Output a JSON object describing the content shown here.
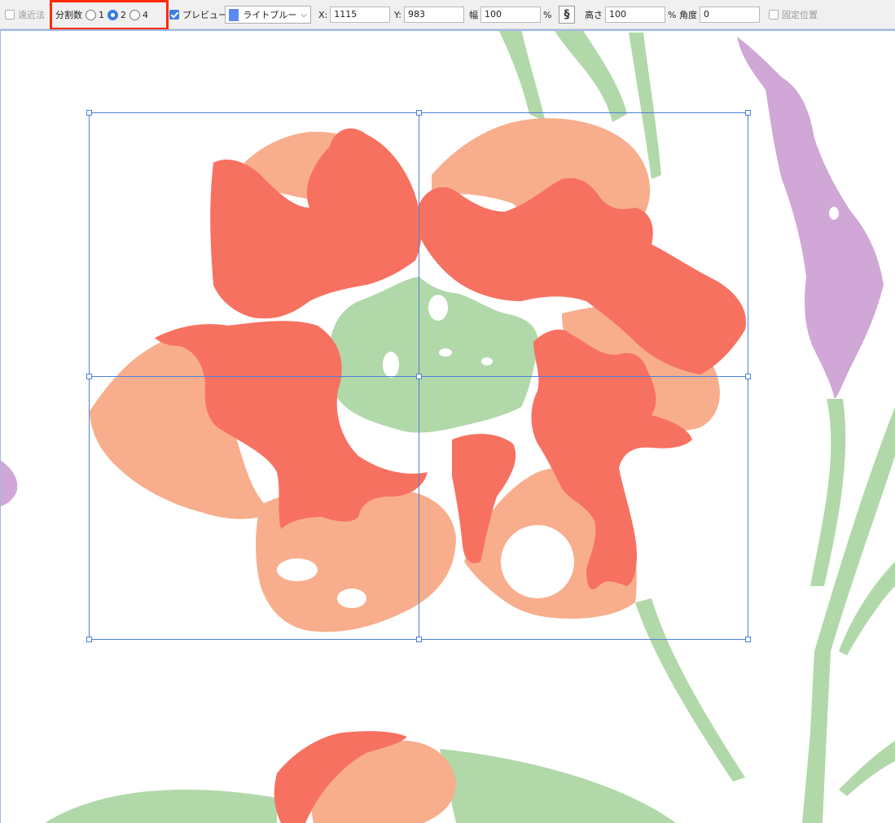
{
  "toolbar": {
    "perspective": {
      "label": "遠近法",
      "checked": false,
      "enabled": false
    },
    "divisions": {
      "label": "分割数",
      "options": [
        "1",
        "2",
        "4"
      ],
      "selected": "2"
    },
    "preview": {
      "label": "プレビュー",
      "checked": true
    },
    "color": {
      "value": "ライトブルー",
      "swatch": "#5b8bf0"
    },
    "x": {
      "label": "X:",
      "value": "1115"
    },
    "y": {
      "label": "Y:",
      "value": "983"
    },
    "width": {
      "label": "幅",
      "value": "100",
      "unit": "%"
    },
    "link_icon": "link-chain-icon",
    "height": {
      "label": "高さ",
      "value": "100",
      "unit": "%"
    },
    "angle": {
      "label": "角度",
      "value": "0"
    },
    "fixed_position": {
      "label": "固定位置",
      "checked": false,
      "enabled": false
    }
  },
  "colors": {
    "petal_dark": "#f77161",
    "petal_light": "#f8ae8c",
    "leaf": "#b1d8a9",
    "lavender": "#d0a7d6",
    "grid": "#4d7fd9"
  }
}
